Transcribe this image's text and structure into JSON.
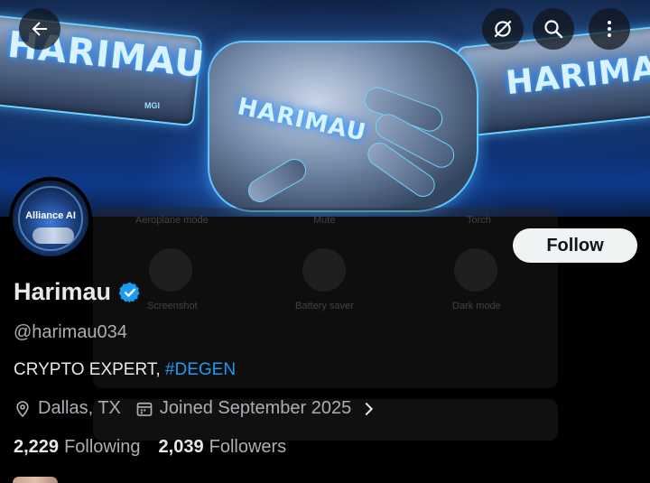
{
  "banner": {
    "brand_text": "HARIMAU",
    "mark_small": "MGI",
    "mark_small_2": "HARIMAU"
  },
  "toolbar": {
    "back": "back-arrow-icon",
    "antenna": "no-signal-icon",
    "search": "search-icon",
    "more": "more-vertical-icon"
  },
  "ghost_overlay": {
    "row1": [
      "Aeroplane mode",
      "Mute",
      "Torch"
    ],
    "row2": [
      "Screenshot",
      "Battery saver",
      "Dark mode"
    ]
  },
  "avatar": {
    "label": "Alliance AI"
  },
  "profile": {
    "follow_label": "Follow",
    "display_name": "Harimau",
    "handle": "@harimau034",
    "bio_text": "CRYPTO EXPERT, ",
    "bio_tag": "#DEGEN",
    "location": "Dallas, TX",
    "joined": "Joined September 2025",
    "following_count": "2,229",
    "following_label": "Following",
    "followers_count": "2,039",
    "followers_label": "Followers"
  },
  "colors": {
    "accent": "#1d9bf0",
    "verified": "#1d9bf0",
    "background": "#000000",
    "secondary_text": "#a9afb4"
  }
}
